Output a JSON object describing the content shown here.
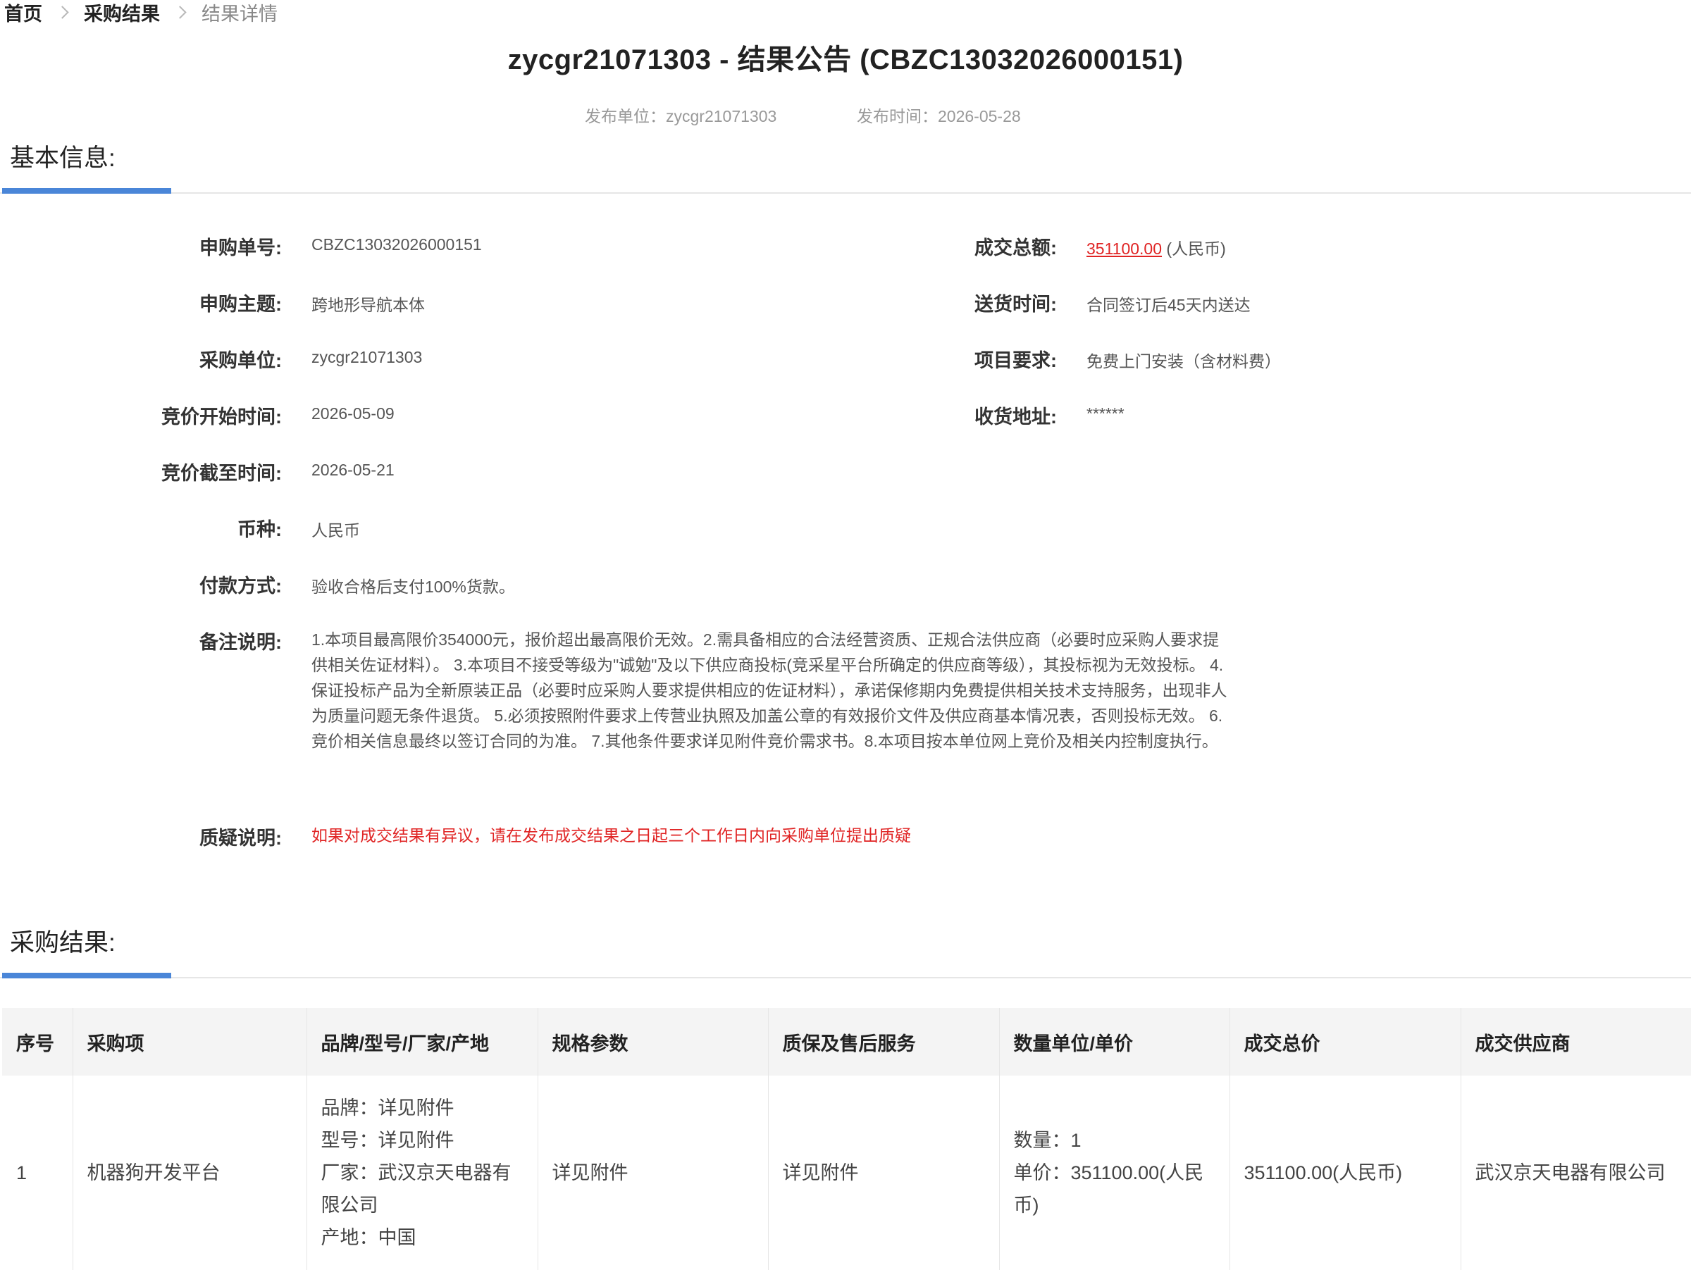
{
  "breadcrumb": {
    "home": "首页",
    "parent": "采购结果",
    "current": "结果详情"
  },
  "title": "zycgr21071303 - 结果公告 (CBZC13032026000151)",
  "meta": {
    "publisher": "发布单位：zycgr21071303",
    "publish_time": "发布时间：2026-05-28"
  },
  "basic_info": {
    "title": "基本信息:",
    "order_no_label": "申购单号:",
    "order_no": "CBZC13032026000151",
    "subject_label": "申购主题:",
    "subject": "跨地形导航本体",
    "buyer_label": "采购单位:",
    "buyer": "zycgr21071303",
    "start_label": "竞价开始时间:",
    "start": "2026-05-09",
    "end_label": "竞价截至时间:",
    "end": "2026-05-21",
    "currency_label": "币种:",
    "currency": "人民币",
    "payment_label": "付款方式:",
    "payment": "验收合格后支付100%货款。",
    "remark_label": "备注说明:",
    "remark": "1.本项目最高限价354000元，报价超出最高限价无效。2.需具备相应的合法经营资质、正规合法供应商（必要时应采购人要求提供相关佐证材料）。 3.本项目不接受等级为\"诚勉\"及以下供应商投标(竞采星平台所确定的供应商等级），其投标视为无效投标。 4.保证投标产品为全新原装正品（必要时应采购人要求提供相应的佐证材料），承诺保修期内免费提供相关技术支持服务，出现非人为质量问题无条件退货。 5.必须按照附件要求上传营业执照及加盖公章的有效报价文件及供应商基本情况表，否则投标无效。 6.竞价相关信息最终以签订合同的为准。 7.其他条件要求详见附件竞价需求书。8.本项目按本单位网上竞价及相关内控制度执行。",
    "objection_label": "质疑说明:",
    "objection": "如果对成交结果有异议，请在发布成交结果之日起三个工作日内向采购单位提出质疑",
    "total_label": "成交总额:",
    "total": "351100.00",
    "total_unit": "(人民币)",
    "delivery_label": "送货时间:",
    "delivery": "合同签订后45天内送达",
    "requirement_label": "项目要求:",
    "requirement": "免费上门安装（含材料费）",
    "address_label": "收货地址:",
    "address": "******"
  },
  "results": {
    "title": "采购结果:",
    "headers": [
      "序号",
      "采购项",
      "品牌/型号/厂家/产地",
      "规格参数",
      "质保及售后服务",
      "数量单位/单价",
      "成交总价",
      "成交供应商"
    ],
    "rows": [
      {
        "no": "1",
        "item": "机器狗开发平台",
        "brand": "品牌：详见附件",
        "model": "型号：详见附件",
        "maker": "厂家：武汉京天电器有限公司",
        "origin": "产地：中国",
        "spec": "详见附件",
        "warranty": "详见附件",
        "quantity": "数量：1",
        "unit_price": "单价：351100.00(人民币)",
        "total": "351100.00(人民币)",
        "supplier": "武汉京天电器有限公司"
      }
    ]
  },
  "colors": {
    "accent": "#4a86d8",
    "alert": "#e02424"
  }
}
